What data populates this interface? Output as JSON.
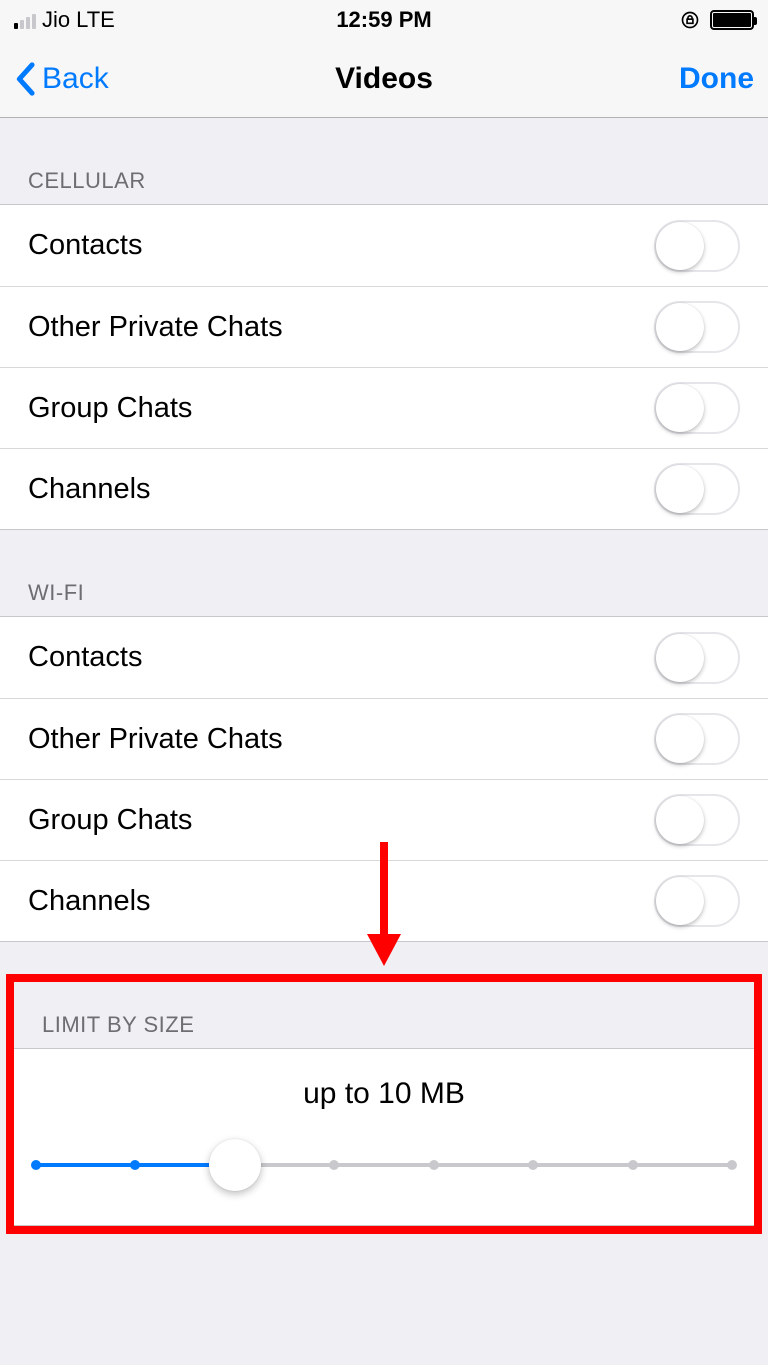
{
  "status": {
    "carrier": "Jio",
    "network": "LTE",
    "time": "12:59 PM"
  },
  "nav": {
    "back_label": "Back",
    "title": "Videos",
    "done_label": "Done"
  },
  "sections": {
    "cellular": {
      "header": "CELLULAR",
      "items": [
        {
          "label": "Contacts",
          "on": false
        },
        {
          "label": "Other Private Chats",
          "on": false
        },
        {
          "label": "Group Chats",
          "on": false
        },
        {
          "label": "Channels",
          "on": false
        }
      ]
    },
    "wifi": {
      "header": "WI-FI",
      "items": [
        {
          "label": "Contacts",
          "on": false
        },
        {
          "label": "Other Private Chats",
          "on": false
        },
        {
          "label": "Group Chats",
          "on": false
        },
        {
          "label": "Channels",
          "on": false
        }
      ]
    },
    "limit": {
      "header": "LIMIT BY SIZE",
      "value_label": "up to 10 MB",
      "slider": {
        "steps": 8,
        "position": 2
      }
    }
  },
  "annotation": {
    "highlight_color": "#ff0000"
  }
}
